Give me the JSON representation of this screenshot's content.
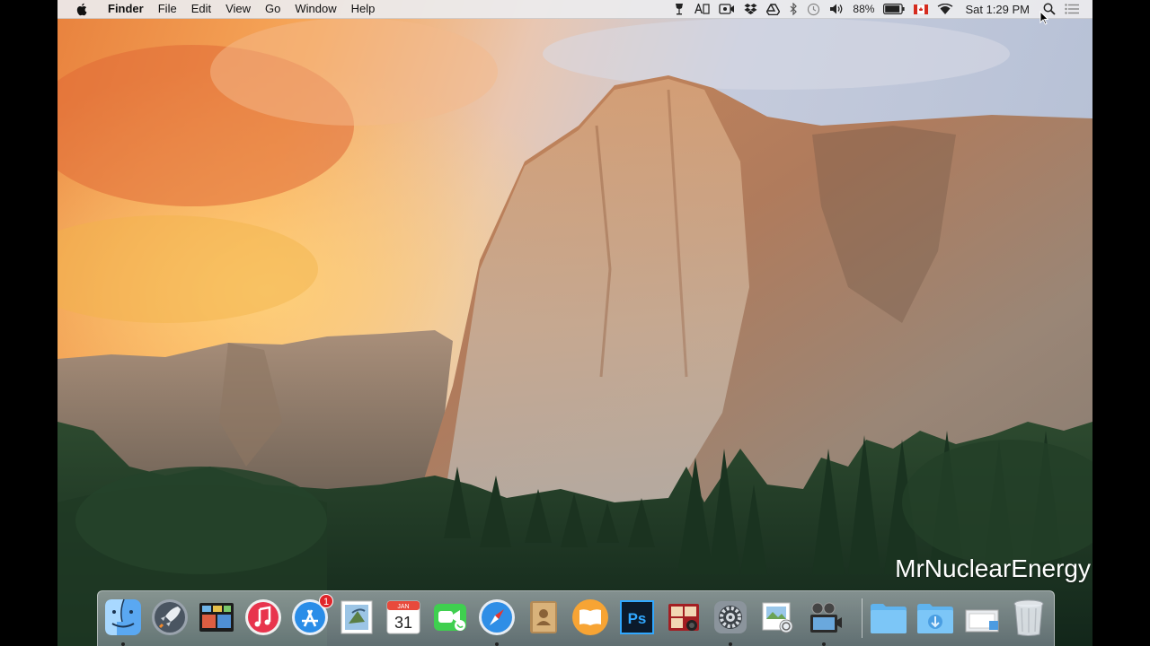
{
  "menubar": {
    "app_name": "Finder",
    "menus": [
      "File",
      "Edit",
      "View",
      "Go",
      "Window",
      "Help"
    ],
    "battery_percent": "88%",
    "clock": "Sat 1:29 PM"
  },
  "watermark": "MrNuclearEnergy",
  "dock": {
    "app_store_badge": "1",
    "calendar_month": "JAN",
    "calendar_day": "31",
    "photoshop_label": "Ps"
  },
  "colors": {
    "menubar_bg": "#ecedf0",
    "sky_orange": "#f39a4a",
    "sky_blue": "#b9c4d8",
    "rock": "#b98a64",
    "forest": "#1e3b26"
  }
}
